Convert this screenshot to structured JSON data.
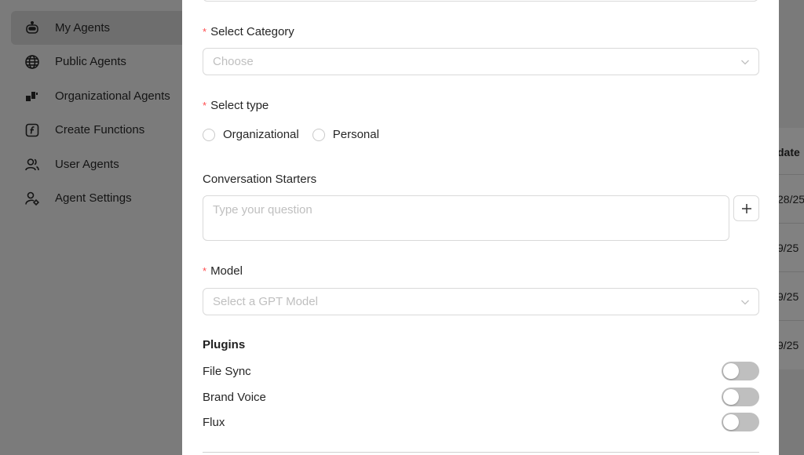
{
  "sidebar": {
    "items": [
      {
        "label": "My Agents",
        "icon": "robot-icon",
        "active": true
      },
      {
        "label": "Public Agents",
        "icon": "globe-icon"
      },
      {
        "label": "Organizational Agents",
        "icon": "blocks-icon"
      },
      {
        "label": "Create Functions",
        "icon": "function-icon"
      },
      {
        "label": "User Agents",
        "icon": "users-icon"
      },
      {
        "label": "Agent Settings",
        "icon": "user-gear-icon"
      }
    ]
  },
  "background_table": {
    "header_fragment": "date",
    "cell_fragments": [
      "28/25",
      "9/25",
      "9/25",
      "9/25"
    ]
  },
  "modal": {
    "category": {
      "label": "Select Category",
      "placeholder": "Choose"
    },
    "type": {
      "label": "Select type",
      "options": [
        "Organizational",
        "Personal"
      ]
    },
    "starters": {
      "label": "Conversation Starters",
      "placeholder": "Type your question"
    },
    "model": {
      "label": "Model",
      "placeholder": "Select a GPT Model"
    },
    "plugins": {
      "title": "Plugins",
      "items": [
        {
          "label": "File Sync",
          "enabled": false
        },
        {
          "label": "Brand Voice",
          "enabled": false
        },
        {
          "label": "Flux",
          "enabled": false
        }
      ]
    },
    "required_mark": "*"
  },
  "colors": {
    "overlay": "#7a7a7a",
    "required": "#ff4d4f",
    "toggle_off": "#bfbfbf",
    "border": "#d9d9d9"
  }
}
